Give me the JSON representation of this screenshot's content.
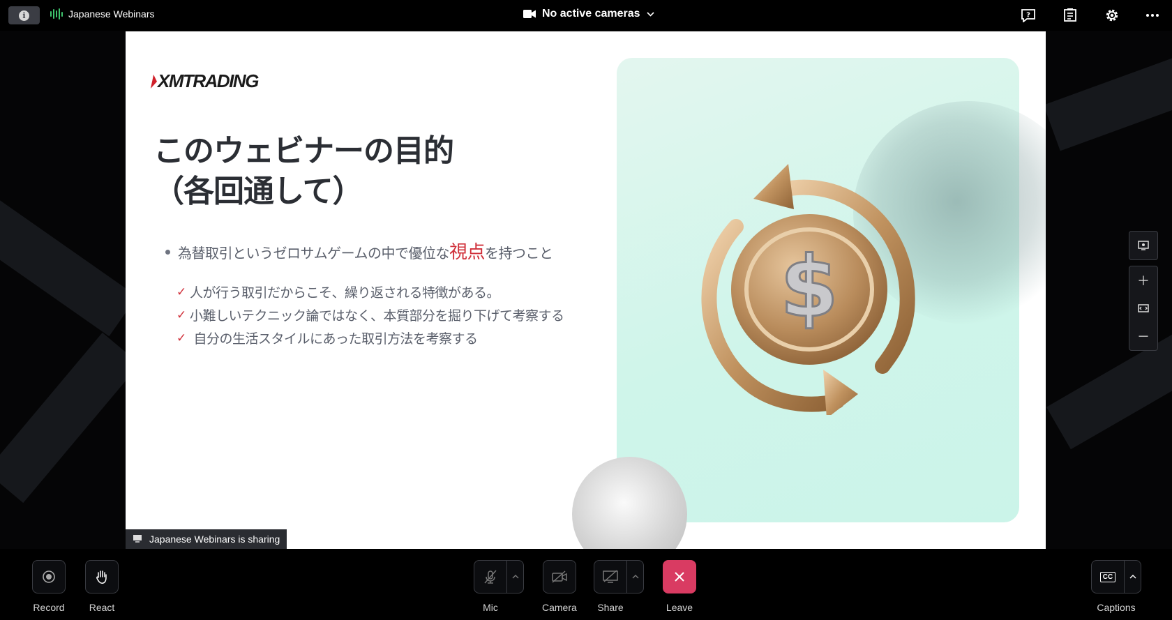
{
  "topbar": {
    "meeting_name": "Japanese Webinars",
    "camera_status": "No active cameras"
  },
  "slide": {
    "logo": "XMTRADING",
    "title": "このウェビナーの目的\n（各回通して）",
    "bullet_before": "為替取引というゼロサムゲームの中で優位な",
    "bullet_highlight": "視点",
    "bullet_after": "を持つこと",
    "checks": [
      "人が行う取引だからこそ、繰り返される特徴がある。",
      "小難しいテクニック論ではなく、本質部分を掘り下げて考察する",
      " 自分の生活スタイルにあった取引方法を考察する"
    ],
    "check_mark": "✓"
  },
  "share_banner": "Japanese Webinars is sharing",
  "toolbar": {
    "record": "Record",
    "react": "React",
    "mic": "Mic",
    "camera": "Camera",
    "share": "Share",
    "leave": "Leave",
    "captions": "Captions",
    "captions_icon_text": "CC"
  },
  "colors": {
    "accent_green": "#3ec46d",
    "leave_red": "#d93b62",
    "highlight_red": "#d0303a"
  },
  "icons": {
    "info": "info-icon",
    "audio": "audio-bars-icon",
    "video": "video-camera-icon",
    "help": "help-icon",
    "notes": "notes-icon",
    "settings": "gear-icon",
    "more": "more-icon"
  }
}
